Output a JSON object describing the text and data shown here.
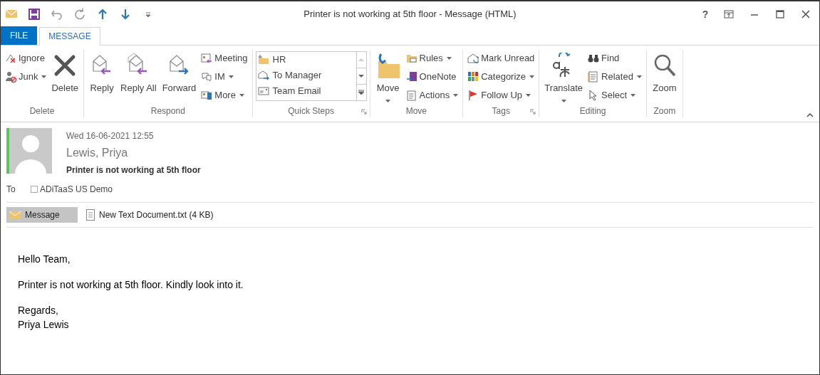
{
  "window": {
    "title": "Printer is not working at 5th floor - Message (HTML)",
    "help": "?"
  },
  "tabs": [
    {
      "label": "FILE",
      "kind": "file",
      "selected": false
    },
    {
      "label": "MESSAGE",
      "kind": "tab",
      "selected": true
    }
  ],
  "ribbon": {
    "expanded": true,
    "groups": [
      {
        "label": "Delete",
        "launcher": false,
        "controls": [
          {
            "kind": "stack",
            "items": [
              {
                "label": "Ignore",
                "dropdown": false
              },
              {
                "label": "Junk",
                "dropdown": true
              }
            ]
          },
          {
            "kind": "large",
            "label": "Delete",
            "dropdown": false
          }
        ]
      },
      {
        "label": "Respond",
        "launcher": false,
        "controls": [
          {
            "kind": "large",
            "label": "Reply",
            "dropdown": false
          },
          {
            "kind": "large",
            "label": "Reply All",
            "dropdown": false
          },
          {
            "kind": "large",
            "label": "Forward",
            "dropdown": false
          },
          {
            "kind": "stack",
            "items": [
              {
                "label": "Meeting",
                "dropdown": false
              },
              {
                "label": "IM",
                "dropdown": true
              },
              {
                "label": "More",
                "dropdown": true
              }
            ]
          }
        ]
      },
      {
        "label": "Quick Steps",
        "launcher": true,
        "controls": [
          {
            "kind": "gallery",
            "items": [
              {
                "label": "HR"
              },
              {
                "label": "To Manager"
              },
              {
                "label": "Team Email"
              }
            ]
          }
        ]
      },
      {
        "label": "Move",
        "launcher": false,
        "controls": [
          {
            "kind": "large",
            "label": "Move",
            "dropdown": true
          },
          {
            "kind": "stack",
            "items": [
              {
                "label": "Rules",
                "dropdown": true
              },
              {
                "label": "OneNote",
                "dropdown": false
              },
              {
                "label": "Actions",
                "dropdown": true
              }
            ]
          }
        ]
      },
      {
        "label": "Tags",
        "launcher": true,
        "controls": [
          {
            "kind": "stack",
            "items": [
              {
                "label": "Mark Unread",
                "dropdown": false
              },
              {
                "label": "Categorize",
                "dropdown": true
              },
              {
                "label": "Follow Up",
                "dropdown": true
              }
            ]
          }
        ]
      },
      {
        "label": "Editing",
        "launcher": false,
        "controls": [
          {
            "kind": "large",
            "label": "Translate",
            "dropdown": true
          },
          {
            "kind": "stack",
            "items": [
              {
                "label": "Find",
                "dropdown": false
              },
              {
                "label": "Related",
                "dropdown": true
              },
              {
                "label": "Select",
                "dropdown": true
              }
            ]
          }
        ]
      },
      {
        "label": "Zoom",
        "launcher": false,
        "controls": [
          {
            "kind": "large",
            "label": "Zoom",
            "dropdown": false
          }
        ]
      }
    ]
  },
  "message": {
    "date": "Wed 16-06-2021 12:55",
    "sender": "Lewis, Priya",
    "subject": "Printer is not working at 5th floor",
    "to_label": "To",
    "recipient": "ADiTaaS US Demo"
  },
  "attachments": [
    {
      "label": "Message",
      "kind": "message",
      "selected": true
    },
    {
      "label": "New Text Document.txt (4 KB)",
      "kind": "file",
      "selected": false
    }
  ],
  "body": [
    {
      "lines": [
        "Hello Team,"
      ]
    },
    {
      "lines": [
        "Printer is not working at 5th floor. Kindly look into it."
      ]
    },
    {
      "lines": [
        "Regards,",
        "Priya Lewis"
      ]
    }
  ]
}
